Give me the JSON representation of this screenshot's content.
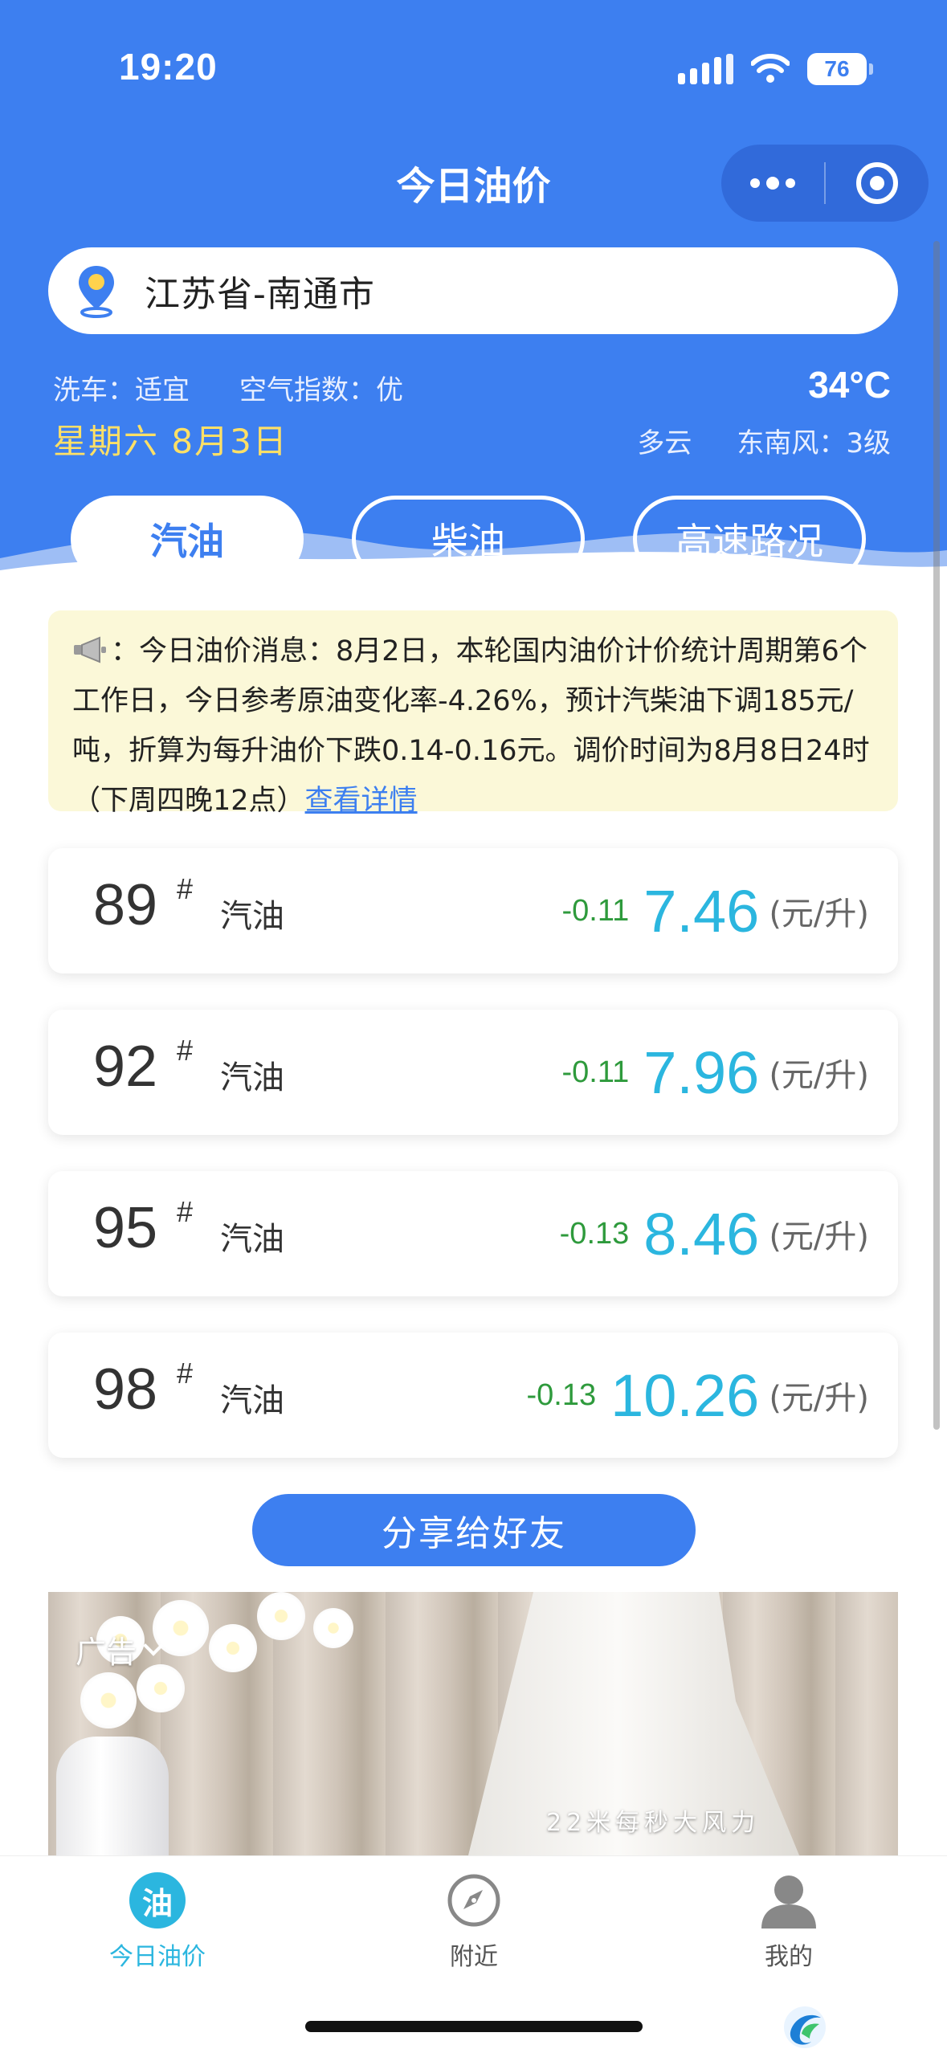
{
  "status_bar": {
    "time": "19:20",
    "battery": "76"
  },
  "nav": {
    "title": "今日油价"
  },
  "location": {
    "text": "江苏省-南通市"
  },
  "weather": {
    "car_wash": "洗车：适宜",
    "air_quality": "空气指数：优",
    "date": "星期六 8月3日",
    "temperature": "34°C",
    "condition": "多云",
    "wind": "东南风：3级"
  },
  "tabs": [
    {
      "label": "汽油",
      "active": true
    },
    {
      "label": "柴油",
      "active": false
    },
    {
      "label": "高速路况",
      "active": false
    }
  ],
  "notice": {
    "prefix": "：",
    "text": "今日油价消息：8月2日，本轮国内油价计价统计周期第6个工作日，今日参考原油变化率-4.26%，预计汽柴油下调185元/吨，折算为每升油价下跌0.14-0.16元。调价时间为8月8日24时（下周四晚12点）",
    "link": "查看详情"
  },
  "prices": [
    {
      "grade": "89",
      "hash": "#",
      "fuel": "汽油",
      "change": "-0.11",
      "price": "7.46",
      "unit": "(元/升)"
    },
    {
      "grade": "92",
      "hash": "#",
      "fuel": "汽油",
      "change": "-0.11",
      "price": "7.96",
      "unit": "(元/升)"
    },
    {
      "grade": "95",
      "hash": "#",
      "fuel": "汽油",
      "change": "-0.13",
      "price": "8.46",
      "unit": "(元/升)"
    },
    {
      "grade": "98",
      "hash": "#",
      "fuel": "汽油",
      "change": "-0.13",
      "price": "10.26",
      "unit": "(元/升)"
    }
  ],
  "share_button": "分享给好友",
  "ad": {
    "label": "广告",
    "caption": "22米每秒大风力"
  },
  "tabbar": [
    {
      "icon_text": "油",
      "label": "今日油价",
      "active": true
    },
    {
      "label": "附近",
      "active": false
    },
    {
      "label": "我的",
      "active": false
    }
  ],
  "colors": {
    "header_blue": "#3d7ff0",
    "price_cyan": "#2bb6df",
    "change_green": "#2e9a3c",
    "date_yellow": "#ffe066",
    "notice_bg": "#fbf8d8"
  }
}
